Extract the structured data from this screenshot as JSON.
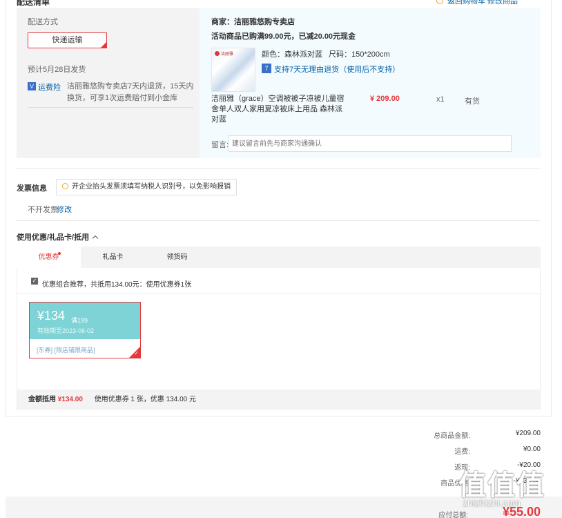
{
  "top": {
    "cut_title": "配送清单",
    "right_links": "返回购物车  修改商品"
  },
  "shipping": {
    "label": "配送方式",
    "method": "快递运输",
    "estimate": "预计5月28日发货",
    "insurance_badge": "V",
    "insurance_label": "运费险",
    "insurance_desc": "洁丽雅悠购专卖店7天内退货，15天内换货，可享1次运费赔付到小金库"
  },
  "order": {
    "seller": "商家：洁丽雅悠购专卖店",
    "promo": "活动商品已购满99.00元，已减20.00元现金",
    "img_brand": "洁丽雅",
    "color": "颜色：森林派对蓝",
    "size": "尺码：150*200cm",
    "return_badge": "7",
    "return_text": "支持7天无理由退货（使用后不支持）",
    "name": "洁丽雅（grace）空调被被子凉被儿童宿舍单人双人家用夏凉被床上用品 森林派对蓝",
    "price": "¥ 209.00",
    "qty": "x1",
    "stock": "有货",
    "note_label": "留言:",
    "note_placeholder": "建议留言前先与商家沟通确认"
  },
  "invoice": {
    "title": "发票信息",
    "tip": "开企业抬头发票须填写纳税人识别号，以免影响报销",
    "none": "不开发票",
    "edit": "修改"
  },
  "coupons": {
    "title": "使用优惠/礼品卡/抵用",
    "tabs": [
      "优惠券",
      "礼品卡",
      "领货码"
    ],
    "combo_check": "✓",
    "combo_text": "优惠组合推荐，共抵用134.00元：使用优惠券1张",
    "card": {
      "amount": "¥134",
      "condition": "满199",
      "expiry": "有效期至2023-06-02",
      "tag": "[东券] [限店铺限商品]",
      "check": "✓"
    },
    "summary_label": "金额抵用",
    "summary_amount": "¥134.00",
    "summary_desc": "使用优惠券 1 张，优惠 134.00 元"
  },
  "totals": {
    "rows": [
      {
        "label": "总商品金额:",
        "value": "¥209.00"
      },
      {
        "label": "运费:",
        "value": "¥0.00"
      },
      {
        "label": "返现:",
        "value": "-¥20.00"
      },
      {
        "label": "商品优惠:",
        "value": "-¥134.00"
      }
    ],
    "pay_label": "应付总额:",
    "pay_value": "¥55.00"
  },
  "watermark": {
    "glyphs": "值值值",
    "text": "zhizhizhi.com"
  }
}
